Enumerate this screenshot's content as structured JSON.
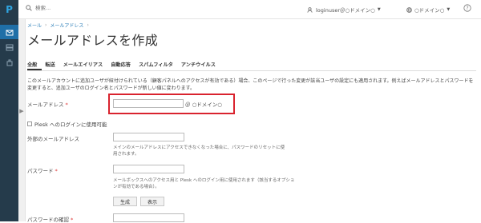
{
  "app": {
    "logo_text": "P",
    "accent_color": "#2a7db7",
    "rail_color": "#253b4b",
    "highlight_color": "#d9232e"
  },
  "topbar": {
    "search_placeholder": "検索...",
    "user_label": "loginuser＠○ドメイン○",
    "domain_label": "○ドメイン○",
    "help_label": "?"
  },
  "breadcrumb": {
    "items": [
      "メール",
      "メールアドレス"
    ]
  },
  "page": {
    "title": "メールアドレスを作成"
  },
  "tabs": [
    "全般",
    "転送",
    "メールエイリアス",
    "自動応答",
    "スパムフィルタ",
    "アンチウイルス"
  ],
  "description": "このメールアカウントに追加ユーザが紐付けられている（顧客パネルへのアクセスが有効である）場合、このページで行った変更が該当ユーザの設定にも適用されます。例えばメールアドレスとパスワードを変更すると、追加ユーザのログイン名とパスワードが新しい値に変わります。",
  "form": {
    "email_label": "メールアドレス",
    "email_value": "",
    "domain_suffix": "＠ ○ドメイン○",
    "plesk_login_label": "Plesk へのログインに使用可能",
    "external_email_label": "外部のメールアドレス",
    "external_email_value": "",
    "external_email_hint": "メインのメールアドレスにアクセスできなくなった場合に、パスワードのリセットに使用されます。",
    "password_label": "パスワード",
    "password_value": "",
    "password_hint": "メールボックスへのアクセス用と Plesk へのログイン用に使用されます（該当するオプションが有効である場合）。",
    "generate_label": "生成",
    "show_label": "表示",
    "confirm_label": "パスワードの確認",
    "required_mark": "*"
  }
}
